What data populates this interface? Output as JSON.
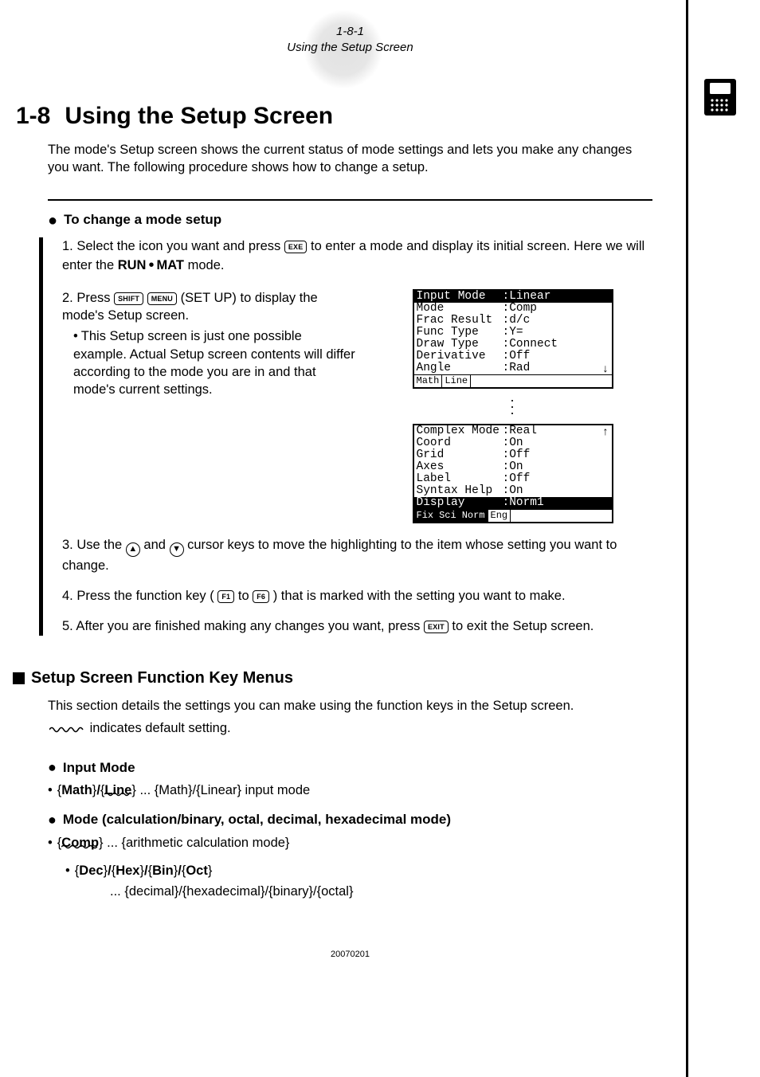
{
  "header": {
    "pageref": "1-8-1",
    "subtitle": "Using the Setup Screen"
  },
  "title": {
    "num": "1-8",
    "text": "Using the Setup Screen"
  },
  "intro": "The mode's Setup screen shows the current status of mode settings and lets you make any changes you want. The following procedure shows how to change a setup.",
  "proc_head": "To change a mode setup",
  "steps": {
    "s1a": "1. Select the icon you want and press ",
    "s1b": " to enter a mode and display its initial screen. Here we will enter the ",
    "s1c": " mode.",
    "s2a": "2. Press ",
    "s2b": " (SET UP) to display the mode's Setup screen.",
    "s2c": "This Setup screen is just one possible example. Actual Setup screen contents will differ according to the mode you are in and that mode's current settings.",
    "s3a": "3. Use the ",
    "s3b": " and ",
    "s3c": " cursor keys to move the highlighting to the item whose setting you want to change.",
    "s4a": "4. Press the function key (",
    "s4b": " to ",
    "s4c": ") that is marked with the setting you want to make.",
    "s5a": "5. After you are finished making any changes you want, press ",
    "s5b": " to exit the Setup screen."
  },
  "keys": {
    "exe": "EXE",
    "shift": "SHIFT",
    "menu": "MENU",
    "f1": "F1",
    "f6": "F6",
    "exit": "EXIT",
    "runmat_a": "RUN",
    "runmat_b": "MAT"
  },
  "calc1": {
    "rows": [
      {
        "k": "Input Mode",
        "v": ":Linear",
        "sel": true
      },
      {
        "k": "Mode",
        "v": ":Comp"
      },
      {
        "k": "Frac Result",
        "v": ":d/c"
      },
      {
        "k": "Func Type",
        "v": ":Y="
      },
      {
        "k": "Draw Type",
        "v": ":Connect"
      },
      {
        "k": "Derivative",
        "v": ":Off"
      },
      {
        "k": "Angle",
        "v": ":Rad"
      }
    ],
    "fkeys": [
      "Math",
      "Line"
    ],
    "arrow": "↓"
  },
  "calc2": {
    "rows": [
      {
        "k": "Complex Mode",
        "v": ":Real"
      },
      {
        "k": "Coord",
        "v": ":On"
      },
      {
        "k": "Grid",
        "v": ":Off"
      },
      {
        "k": "Axes",
        "v": ":On"
      },
      {
        "k": "Label",
        "v": ":Off"
      },
      {
        "k": "Syntax Help",
        "v": ":On"
      },
      {
        "k": "Display",
        "v": ":Norm1",
        "sel": true
      }
    ],
    "fkeys": [
      "Fix",
      "Sci",
      "Norm",
      "Eng"
    ],
    "arrow": "↑"
  },
  "section2": "Setup Screen Function Key Menus",
  "sec2_intro": "This section details the settings you can make using the function keys in the Setup screen.",
  "default_note": " indicates default setting.",
  "input_mode": {
    "head": "Input Mode",
    "opt_a": "Math",
    "opt_b": "Line",
    "desc": " ... {Math}/{Linear} input mode"
  },
  "mode": {
    "head": "Mode (calculation/binary, octal, decimal, hexadecimal mode)",
    "opt1": "Comp",
    "opt1_desc": " ... {arithmetic calculation mode}",
    "opt2a": "Dec",
    "opt2b": "Hex",
    "opt2c": "Bin",
    "opt2d": "Oct",
    "opt2_desc": "... {decimal}/{hexadecimal}/{binary}/{octal}"
  },
  "footer": "20070201"
}
